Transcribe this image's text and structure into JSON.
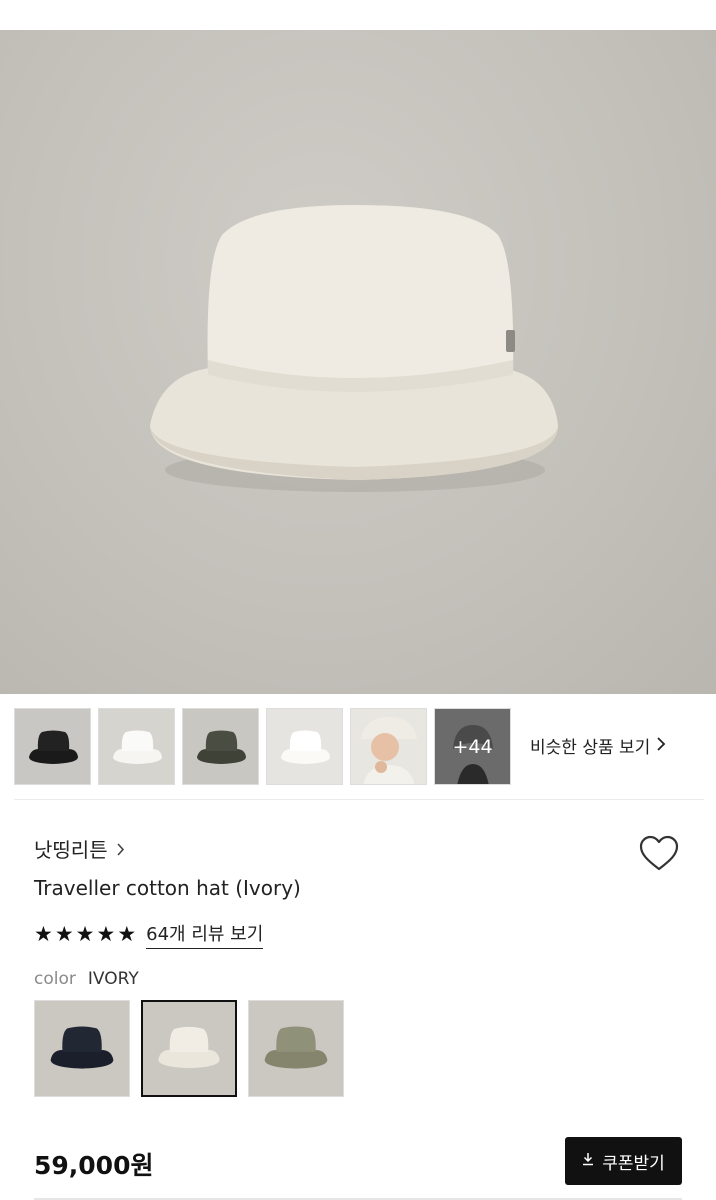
{
  "product": {
    "brand": "낫띵리튼",
    "title": "Traveller cotton hat (Ivory)",
    "rating_stars": 5,
    "review_link": "64개 리뷰 보기",
    "color_label": "color",
    "color_value": "IVORY",
    "price": "59,000원"
  },
  "thumbnails": {
    "more_label": "+44",
    "similar_link": "비슷한 상품 보기"
  },
  "coupon": {
    "label": "쿠폰받기"
  },
  "swatches": [
    {
      "color": "navy",
      "hex": "#1f2330"
    },
    {
      "color": "ivory",
      "hex": "#ece8df"
    },
    {
      "color": "khaki",
      "hex": "#8a8a70"
    }
  ]
}
